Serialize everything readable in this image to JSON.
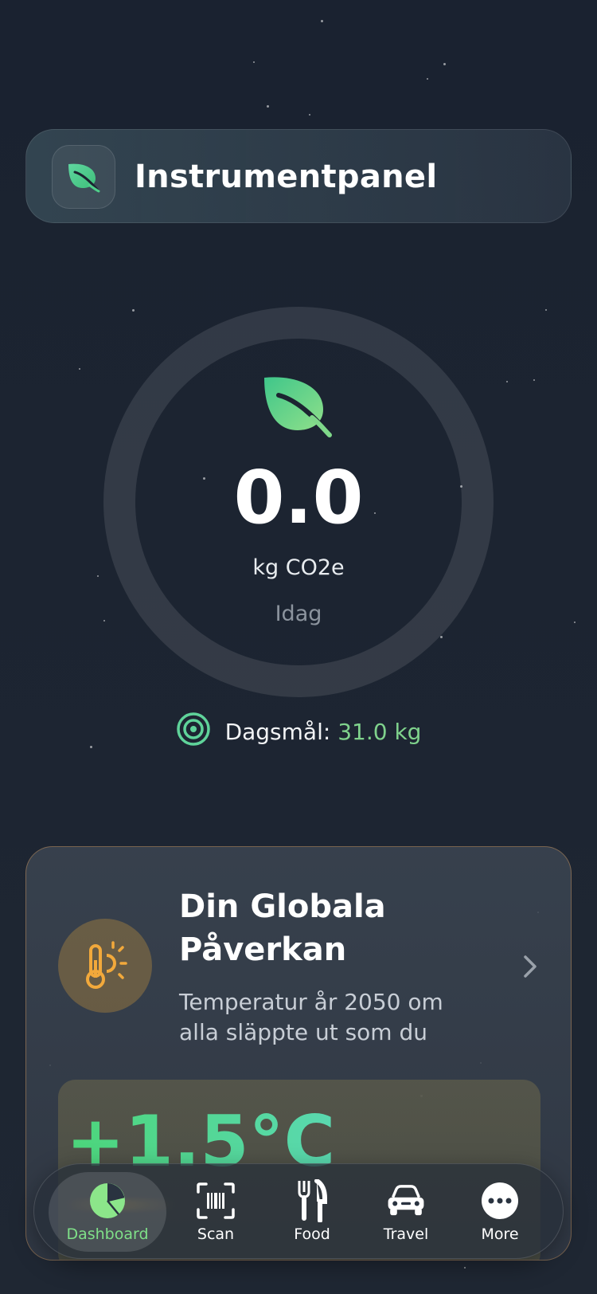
{
  "header": {
    "title": "Instrumentpanel",
    "icon": "leaf-icon"
  },
  "summary": {
    "value": "0.0",
    "unit": "kg CO2e",
    "period": "Idag",
    "progress": 0,
    "icon": "leaf-icon"
  },
  "goal": {
    "label": "Dagsmål:",
    "value": "31.0 kg",
    "icon": "target-icon"
  },
  "impact_card": {
    "title": "Din Globala Påverkan",
    "subtitle": "Temperatur år 2050 om alla släppte ut som du",
    "temperature": "+1.5°C",
    "icon": "thermometer-sun-icon",
    "chevron": "chevron-right-icon"
  },
  "tabs": [
    {
      "label": "Dashboard",
      "icon": "pie-chart-icon",
      "active": true
    },
    {
      "label": "Scan",
      "icon": "barcode-scan-icon",
      "active": false
    },
    {
      "label": "Food",
      "icon": "fork-knife-icon",
      "active": false
    },
    {
      "label": "Travel",
      "icon": "car-icon",
      "active": false
    },
    {
      "label": "More",
      "icon": "ellipsis-icon",
      "active": false
    }
  ],
  "colors": {
    "accent_green": "#7fd28c",
    "accent_orange": "#e6a83a",
    "background": "#1c2431"
  }
}
